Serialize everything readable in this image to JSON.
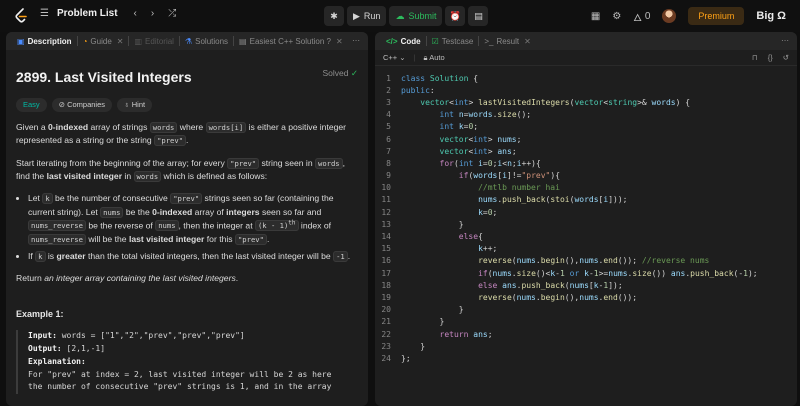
{
  "app": {
    "nav_title": "Problem List",
    "run_label": "Run",
    "submit_label": "Submit",
    "streak": "0",
    "premium_label": "Premium",
    "big_label": "Big Ω"
  },
  "left_tabs": [
    {
      "label": "Description",
      "icon": "document-icon",
      "active": true
    },
    {
      "label": "Guide",
      "icon": "guide-icon",
      "active": false
    },
    {
      "label": "Editorial",
      "icon": "book-icon",
      "active": false
    },
    {
      "label": "Solutions",
      "icon": "flask-icon",
      "active": false
    },
    {
      "label": "Easiest C++ Solution ?",
      "icon": "doc-icon",
      "active": false
    }
  ],
  "right_tabs": [
    {
      "label": "Code",
      "icon": "code-icon",
      "active": true
    },
    {
      "label": "Testcase",
      "icon": "checkbox-icon",
      "active": false
    },
    {
      "label": "Result",
      "icon": "terminal-icon",
      "active": false
    }
  ],
  "editor": {
    "language": "C++",
    "mode": "Auto"
  },
  "problem": {
    "title": "2899. Last Visited Integers",
    "status": "Solved",
    "tags": [
      "Easy",
      "Companies",
      "Hint"
    ],
    "p1": [
      "Given a ",
      "0-indexed",
      " array of strings ",
      "words",
      " where ",
      "words[i]",
      " is either a positive integer represented as a string or the string ",
      "\"prev\"",
      "."
    ],
    "p2": [
      "Start iterating from the beginning of the array; for every ",
      "\"prev\"",
      " string seen in ",
      "words",
      ", find the ",
      "last visited integer",
      " in ",
      "words",
      " which is defined as follows:"
    ],
    "b1": [
      "Let ",
      "k",
      " be the number of consecutive ",
      "\"prev\"",
      " strings seen so far (containing the current string). Let ",
      "nums",
      " be the ",
      "0-indexed",
      " array of ",
      "integers",
      " seen so far and ",
      "nums_reverse",
      " be the reverse of ",
      "nums",
      ", then the integer at ",
      "(k - 1)",
      "th",
      " index of ",
      "nums_reverse",
      " will be the ",
      "last visited integer",
      " for this ",
      "\"prev\"",
      "."
    ],
    "b2": [
      "If ",
      "k",
      " is ",
      "greater",
      " than the total visited integers, then the last visited integer will be ",
      "-1",
      "."
    ],
    "ret": [
      "Return ",
      "an integer array containing the last visited integers",
      "."
    ],
    "example_title": "Example 1:",
    "ex_input_label": "Input:",
    "ex_input": " words = [\"1\",\"2\",\"prev\",\"prev\",\"prev\"]",
    "ex_output_label": "Output:",
    "ex_output": " [2,1,-1]",
    "ex_expl_label": "Explanation:",
    "ex_expl1": "For \"prev\" at index = 2, last visited integer will be 2 as here",
    "ex_expl2": "the number of consecutive \"prev\" strings is 1, and in the array"
  },
  "code_lines": [
    "class Solution {",
    "public:",
    "    vector<int> lastVisitedIntegers(vector<string>& words) {",
    "        int n=words.size();",
    "        int k=0;",
    "        vector<int> nums;",
    "        vector<int> ans;",
    "        for(int i=0;i<n;i++){",
    "            if(words[i]!=\"prev\"){",
    "                //mtlb number hai",
    "                nums.push_back(stoi(words[i]));",
    "                k=0;",
    "            }",
    "            else{",
    "                k++;",
    "                reverse(nums.begin(),nums.end()); //reverse nums",
    "                if(nums.size()<k-1 or k-1>=nums.size()) ans.push_back(-1);",
    "                else ans.push_back(nums[k-1]);",
    "                reverse(nums.begin(),nums.end());",
    "            }",
    "        }",
    "        return ans;",
    "    }",
    "};"
  ]
}
